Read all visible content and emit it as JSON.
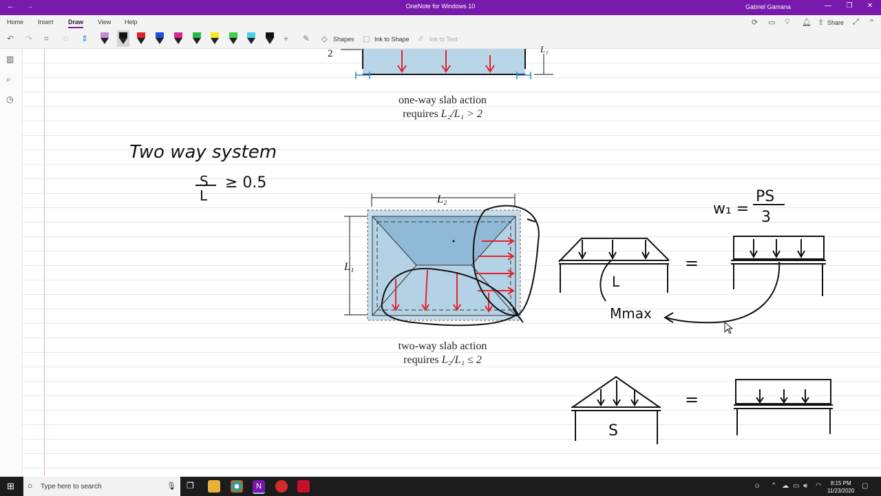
{
  "titlebar": {
    "title": "OneNote for Windows 10",
    "user": "Gabriel Gamana",
    "back_icon": "←",
    "forward_icon": "→",
    "min_icon": "—",
    "restore_icon": "❐",
    "close_icon": "✕"
  },
  "ribbon": {
    "tabs": [
      "Home",
      "Insert",
      "Draw",
      "View",
      "Help"
    ],
    "active_tab": "Draw",
    "shapes_label": "Shapes",
    "ink_to_shape_label": "Ink to Shape",
    "ink_to_text_label": "Ink to Text",
    "share_label": "Share",
    "pens": [
      {
        "name": "highlighter-pen",
        "color": "#c58ad6"
      },
      {
        "name": "black-pen-selected",
        "color": "#111111"
      },
      {
        "name": "red-pen",
        "color": "#e2222b"
      },
      {
        "name": "blue-pen",
        "color": "#1f4fd8"
      },
      {
        "name": "pink-pen",
        "color": "#e0238f"
      },
      {
        "name": "green-pen",
        "color": "#2cb64a"
      },
      {
        "name": "yellow-highlighter",
        "color": "#f7e51d"
      },
      {
        "name": "green-highlighter",
        "color": "#3ed04a"
      },
      {
        "name": "cyan-highlighter",
        "color": "#45d0e8"
      },
      {
        "name": "black-pen",
        "color": "#111111"
      }
    ]
  },
  "canvas": {
    "fig1_caption_line1": "one-way slab action",
    "fig1_caption_line2_prefix": "requires ",
    "fig1_caption_line2_math": "L₂/L₁ > 2",
    "fig1_left_label": "2",
    "fig1_right_label": "L₁",
    "fig2_caption_line1": "two-way slab action",
    "fig2_caption_line2_prefix": "requires ",
    "fig2_caption_line2_math": "L₂/L₁ ≤ 2",
    "fig2_top_label": "L₂",
    "fig2_left_label": "L₁",
    "handwriting": {
      "heading": "Two way system",
      "ratio_num": "S",
      "ratio_den": "L",
      "ratio_rhs": "≥ 0.5",
      "formula_lhs": "w₁ =",
      "formula_num": "PS",
      "formula_den": "3",
      "beam1_label": "L",
      "mmax_label": "Mmax",
      "beam2_label": "S",
      "equals": "="
    }
  },
  "sidebar": {
    "icons": [
      "library-icon",
      "search-icon",
      "recent-icon"
    ]
  },
  "taskbar": {
    "search_placeholder": "Type here to search",
    "time": "8:15 PM",
    "date": "11/23/2020"
  }
}
